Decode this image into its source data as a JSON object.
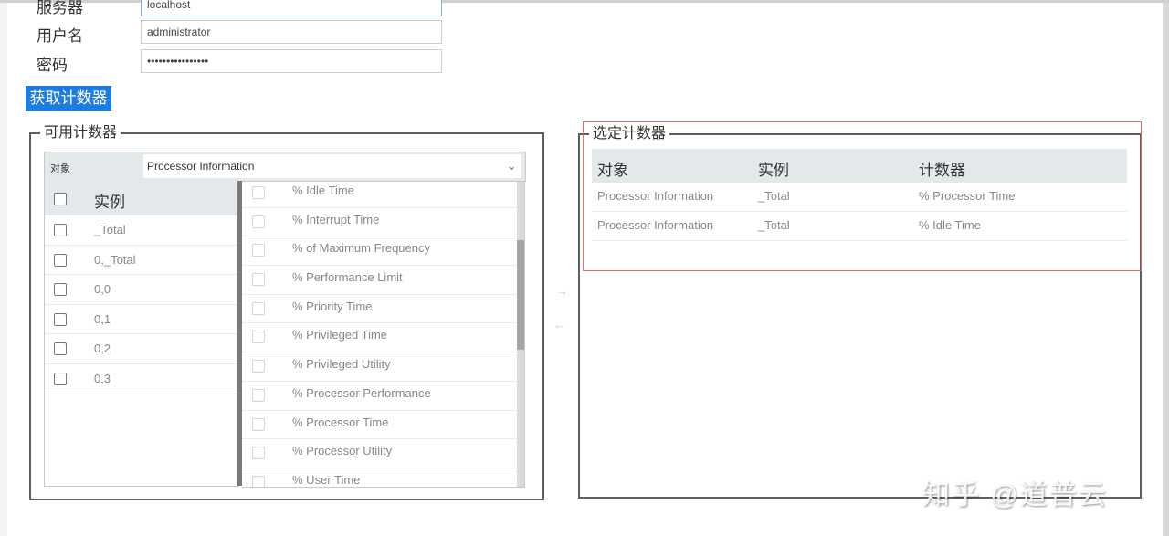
{
  "form": {
    "server_label": "服务器",
    "server_value": "localhost",
    "username_label": "用户名",
    "username_value": "administrator",
    "password_label": "密码",
    "password_value": "••••••••••••••••",
    "fetch_button": "获取计数器"
  },
  "available": {
    "legend": "可用计数器",
    "object_label": "对象",
    "object_selected": "Processor Information",
    "instance_header": "实例",
    "instances": [
      "_Total",
      "0,_Total",
      "0,0",
      "0,1",
      "0,2",
      "0,3"
    ],
    "counters": [
      "% Idle Time",
      "% Interrupt Time",
      "% of Maximum Frequency",
      "% Performance Limit",
      "% Priority Time",
      "% Privileged Time",
      "% Privileged Utility",
      "% Processor Performance",
      "% Processor Time",
      "% Processor Utility",
      "% User Time"
    ],
    "scroll_position": 0.3
  },
  "transfer": {
    "add_icon": "→",
    "remove_icon": "←"
  },
  "selected": {
    "legend": "选定计数器",
    "headers": [
      "对象",
      "实例",
      "计数器"
    ],
    "rows": [
      [
        "Processor Information",
        "_Total",
        "% Processor Time"
      ],
      [
        "Processor Information",
        "_Total",
        "% Idle Time"
      ]
    ]
  },
  "watermark": "知乎 @道普云",
  "colors": {
    "accent": "#1e7be0",
    "highlight_border": "#e06b6b",
    "header_bg": "#e3e8ea"
  }
}
